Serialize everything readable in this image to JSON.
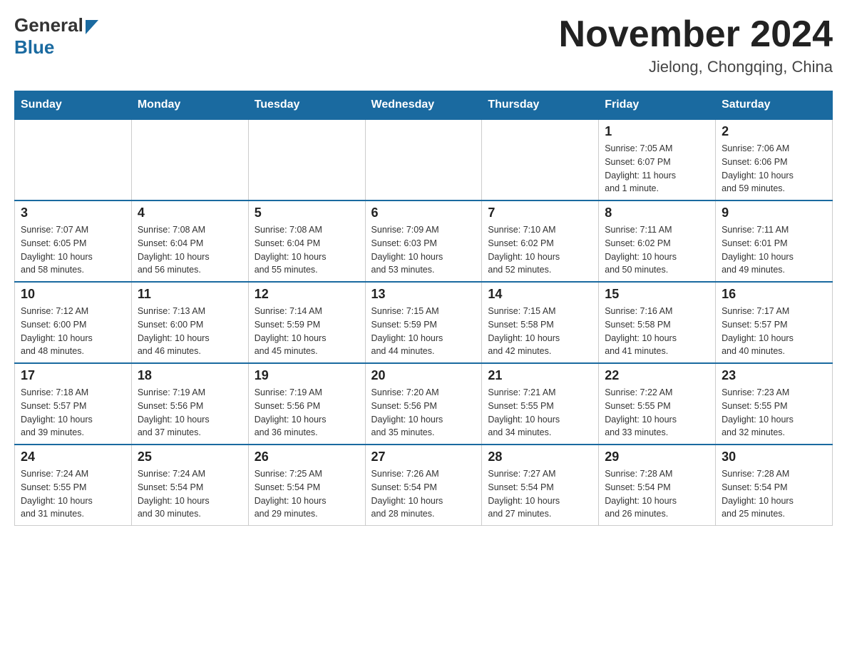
{
  "header": {
    "logo_general": "General",
    "logo_blue": "Blue",
    "month_title": "November 2024",
    "location": "Jielong, Chongqing, China"
  },
  "days_of_week": [
    "Sunday",
    "Monday",
    "Tuesday",
    "Wednesday",
    "Thursday",
    "Friday",
    "Saturday"
  ],
  "weeks": [
    [
      {
        "day": "",
        "info": ""
      },
      {
        "day": "",
        "info": ""
      },
      {
        "day": "",
        "info": ""
      },
      {
        "day": "",
        "info": ""
      },
      {
        "day": "",
        "info": ""
      },
      {
        "day": "1",
        "info": "Sunrise: 7:05 AM\nSunset: 6:07 PM\nDaylight: 11 hours\nand 1 minute."
      },
      {
        "day": "2",
        "info": "Sunrise: 7:06 AM\nSunset: 6:06 PM\nDaylight: 10 hours\nand 59 minutes."
      }
    ],
    [
      {
        "day": "3",
        "info": "Sunrise: 7:07 AM\nSunset: 6:05 PM\nDaylight: 10 hours\nand 58 minutes."
      },
      {
        "day": "4",
        "info": "Sunrise: 7:08 AM\nSunset: 6:04 PM\nDaylight: 10 hours\nand 56 minutes."
      },
      {
        "day": "5",
        "info": "Sunrise: 7:08 AM\nSunset: 6:04 PM\nDaylight: 10 hours\nand 55 minutes."
      },
      {
        "day": "6",
        "info": "Sunrise: 7:09 AM\nSunset: 6:03 PM\nDaylight: 10 hours\nand 53 minutes."
      },
      {
        "day": "7",
        "info": "Sunrise: 7:10 AM\nSunset: 6:02 PM\nDaylight: 10 hours\nand 52 minutes."
      },
      {
        "day": "8",
        "info": "Sunrise: 7:11 AM\nSunset: 6:02 PM\nDaylight: 10 hours\nand 50 minutes."
      },
      {
        "day": "9",
        "info": "Sunrise: 7:11 AM\nSunset: 6:01 PM\nDaylight: 10 hours\nand 49 minutes."
      }
    ],
    [
      {
        "day": "10",
        "info": "Sunrise: 7:12 AM\nSunset: 6:00 PM\nDaylight: 10 hours\nand 48 minutes."
      },
      {
        "day": "11",
        "info": "Sunrise: 7:13 AM\nSunset: 6:00 PM\nDaylight: 10 hours\nand 46 minutes."
      },
      {
        "day": "12",
        "info": "Sunrise: 7:14 AM\nSunset: 5:59 PM\nDaylight: 10 hours\nand 45 minutes."
      },
      {
        "day": "13",
        "info": "Sunrise: 7:15 AM\nSunset: 5:59 PM\nDaylight: 10 hours\nand 44 minutes."
      },
      {
        "day": "14",
        "info": "Sunrise: 7:15 AM\nSunset: 5:58 PM\nDaylight: 10 hours\nand 42 minutes."
      },
      {
        "day": "15",
        "info": "Sunrise: 7:16 AM\nSunset: 5:58 PM\nDaylight: 10 hours\nand 41 minutes."
      },
      {
        "day": "16",
        "info": "Sunrise: 7:17 AM\nSunset: 5:57 PM\nDaylight: 10 hours\nand 40 minutes."
      }
    ],
    [
      {
        "day": "17",
        "info": "Sunrise: 7:18 AM\nSunset: 5:57 PM\nDaylight: 10 hours\nand 39 minutes."
      },
      {
        "day": "18",
        "info": "Sunrise: 7:19 AM\nSunset: 5:56 PM\nDaylight: 10 hours\nand 37 minutes."
      },
      {
        "day": "19",
        "info": "Sunrise: 7:19 AM\nSunset: 5:56 PM\nDaylight: 10 hours\nand 36 minutes."
      },
      {
        "day": "20",
        "info": "Sunrise: 7:20 AM\nSunset: 5:56 PM\nDaylight: 10 hours\nand 35 minutes."
      },
      {
        "day": "21",
        "info": "Sunrise: 7:21 AM\nSunset: 5:55 PM\nDaylight: 10 hours\nand 34 minutes."
      },
      {
        "day": "22",
        "info": "Sunrise: 7:22 AM\nSunset: 5:55 PM\nDaylight: 10 hours\nand 33 minutes."
      },
      {
        "day": "23",
        "info": "Sunrise: 7:23 AM\nSunset: 5:55 PM\nDaylight: 10 hours\nand 32 minutes."
      }
    ],
    [
      {
        "day": "24",
        "info": "Sunrise: 7:24 AM\nSunset: 5:55 PM\nDaylight: 10 hours\nand 31 minutes."
      },
      {
        "day": "25",
        "info": "Sunrise: 7:24 AM\nSunset: 5:54 PM\nDaylight: 10 hours\nand 30 minutes."
      },
      {
        "day": "26",
        "info": "Sunrise: 7:25 AM\nSunset: 5:54 PM\nDaylight: 10 hours\nand 29 minutes."
      },
      {
        "day": "27",
        "info": "Sunrise: 7:26 AM\nSunset: 5:54 PM\nDaylight: 10 hours\nand 28 minutes."
      },
      {
        "day": "28",
        "info": "Sunrise: 7:27 AM\nSunset: 5:54 PM\nDaylight: 10 hours\nand 27 minutes."
      },
      {
        "day": "29",
        "info": "Sunrise: 7:28 AM\nSunset: 5:54 PM\nDaylight: 10 hours\nand 26 minutes."
      },
      {
        "day": "30",
        "info": "Sunrise: 7:28 AM\nSunset: 5:54 PM\nDaylight: 10 hours\nand 25 minutes."
      }
    ]
  ]
}
